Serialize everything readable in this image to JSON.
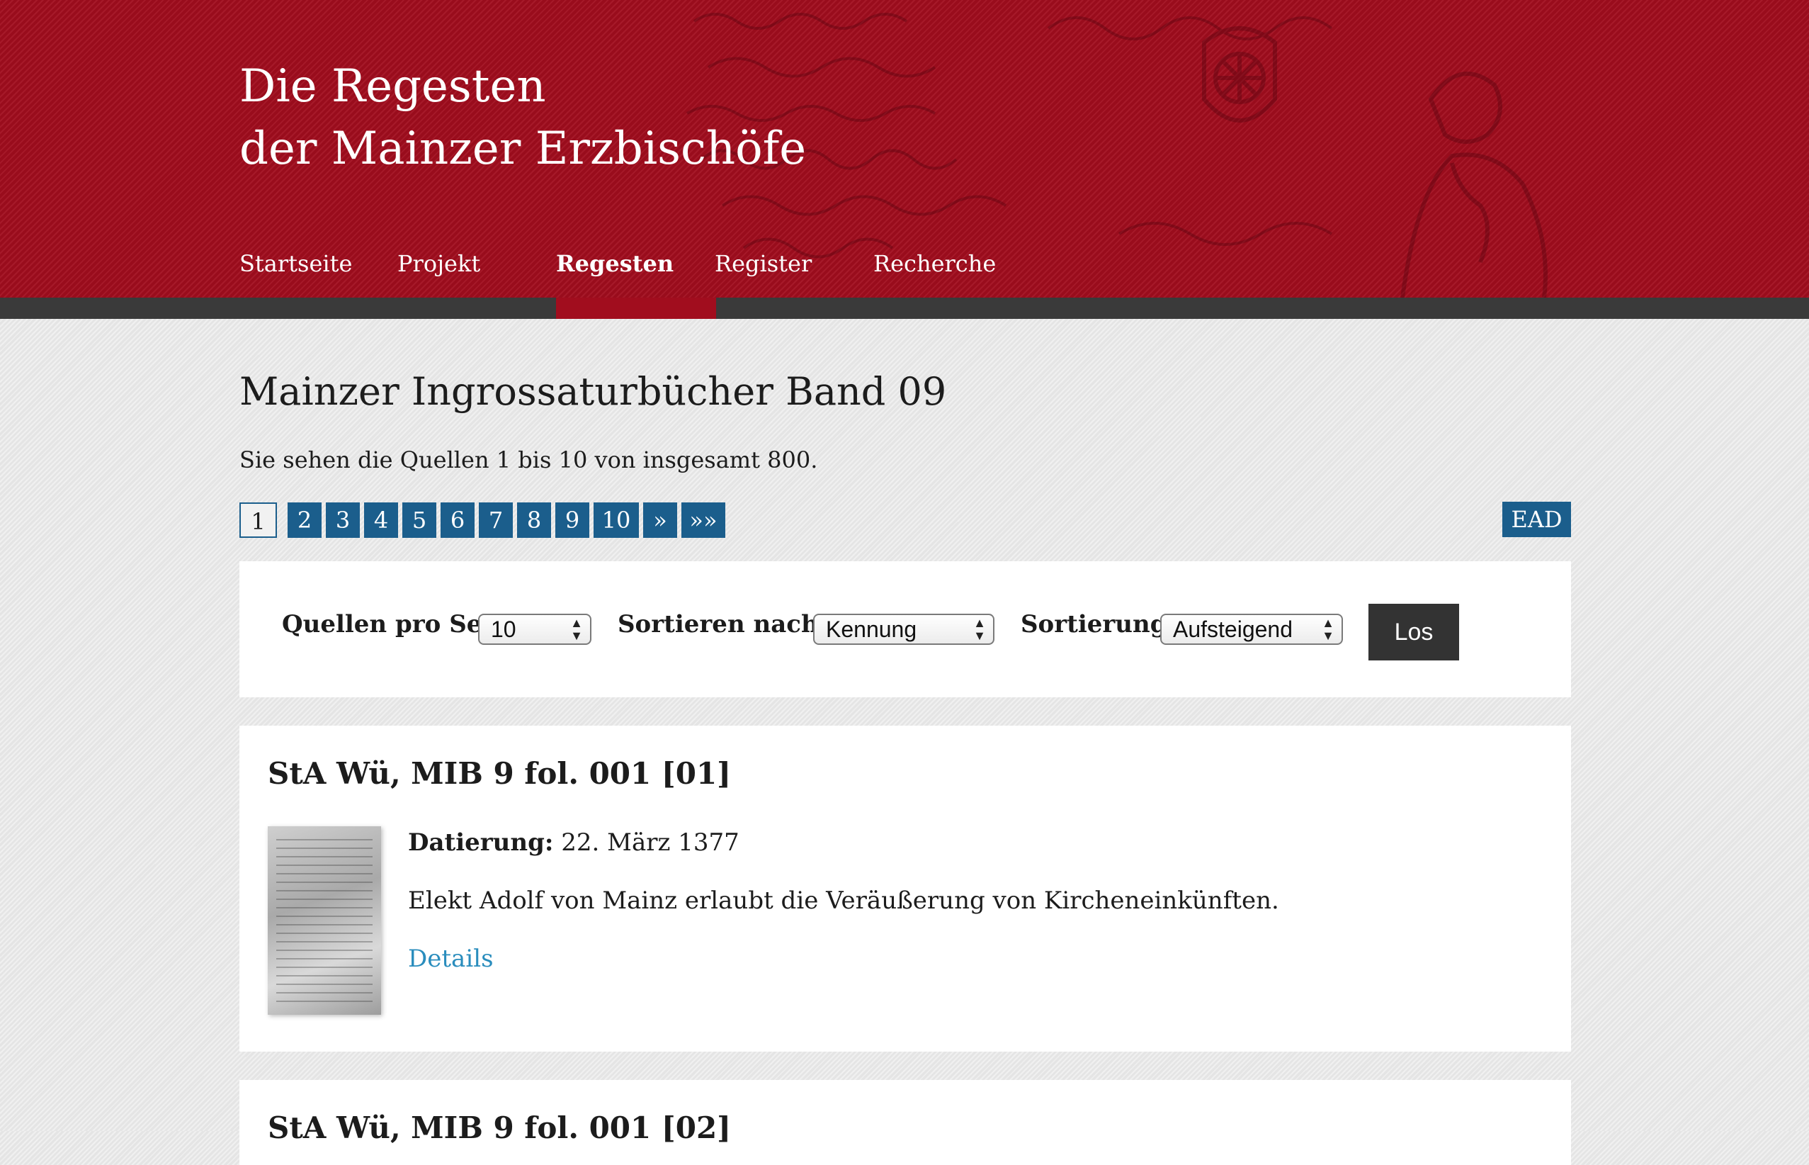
{
  "header": {
    "title_line1": "Die Regesten",
    "title_line2": "der Mainzer Erzbischöfe"
  },
  "nav": {
    "items": [
      {
        "label": "Startseite"
      },
      {
        "label": "Projekt"
      },
      {
        "label": "Regesten"
      },
      {
        "label": "Register"
      },
      {
        "label": "Recherche"
      }
    ],
    "active": "Regesten"
  },
  "main": {
    "title": "Mainzer Ingrossaturbücher Band 09",
    "result_info": "Sie sehen die Quellen 1 bis 10 von insgesamt 800.",
    "pagination": [
      "1",
      "2",
      "3",
      "4",
      "5",
      "6",
      "7",
      "8",
      "9",
      "10",
      "»",
      "»»"
    ],
    "current_page": "1",
    "ead_label": "EAD"
  },
  "filters": {
    "per_page_label": "Quellen pro Seite",
    "per_page_value": "10",
    "sort_by_label": "Sortieren nach",
    "sort_by_value": "Kennung",
    "order_label": "Sortierung",
    "order_value": "Aufsteigend",
    "submit_label": "Los"
  },
  "records": [
    {
      "title": "StA Wü, MIB 9 fol. 001 [01]",
      "date_label": "Datierung:",
      "date_value": "22. März 1377",
      "summary": "Elekt Adolf von Mainz erlaubt die Veräußerung von Kircheneinkünften.",
      "details_label": "Details"
    },
    {
      "title": "StA Wü, MIB 9 fol. 001 [02]"
    }
  ],
  "colors": {
    "header_red": "#a10d1e",
    "nav_strip": "#3a3a3a",
    "pager_blue": "#1b5e8c",
    "link_blue": "#2a8dbd",
    "button_dark": "#333333"
  }
}
